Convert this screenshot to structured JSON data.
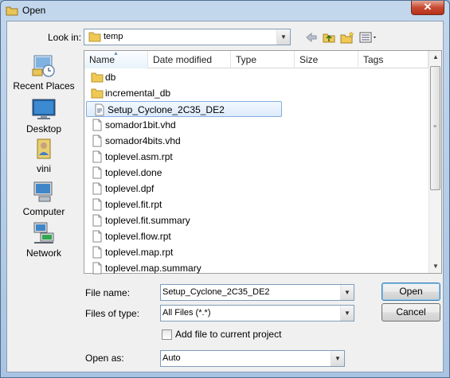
{
  "window": {
    "title": "Open",
    "close_glyph": "✕"
  },
  "toolbar": {
    "look_in_label": "Look in:",
    "look_in_value": "temp",
    "icons": [
      "back-arrow-icon",
      "up-folder-icon",
      "new-folder-icon",
      "view-menu-icon"
    ]
  },
  "places": [
    {
      "label": "Recent Places",
      "icon": "recent-places-icon"
    },
    {
      "label": "Desktop",
      "icon": "desktop-icon"
    },
    {
      "label": "vini",
      "icon": "user-folder-icon"
    },
    {
      "label": "Computer",
      "icon": "computer-icon"
    },
    {
      "label": "Network",
      "icon": "network-icon"
    }
  ],
  "columns": [
    "Name",
    "Date modified",
    "Type",
    "Size",
    "Tags"
  ],
  "files": [
    {
      "name": "db",
      "kind": "folder"
    },
    {
      "name": "incremental_db",
      "kind": "folder"
    },
    {
      "name": "Setup_Cyclone_2C35_DE2",
      "kind": "qsf",
      "selected": true
    },
    {
      "name": "somador1bit.vhd",
      "kind": "file"
    },
    {
      "name": "somador4bits.vhd",
      "kind": "file"
    },
    {
      "name": "toplevel.asm.rpt",
      "kind": "file"
    },
    {
      "name": "toplevel.done",
      "kind": "file"
    },
    {
      "name": "toplevel.dpf",
      "kind": "file"
    },
    {
      "name": "toplevel.fit.rpt",
      "kind": "file"
    },
    {
      "name": "toplevel.fit.summary",
      "kind": "file"
    },
    {
      "name": "toplevel.flow.rpt",
      "kind": "file"
    },
    {
      "name": "toplevel.map.rpt",
      "kind": "file"
    },
    {
      "name": "toplevel.map.summary",
      "kind": "file"
    }
  ],
  "form": {
    "file_name_label": "File name:",
    "file_name_value": "Setup_Cyclone_2C35_DE2",
    "files_of_type_label": "Files of type:",
    "files_of_type_value": "All Files (*.*)",
    "add_to_project_label": "Add file to current project",
    "add_to_project_checked": false,
    "open_as_label": "Open as:",
    "open_as_value": "Auto",
    "open_button": "Open",
    "cancel_button": "Cancel"
  },
  "colors": {
    "title_gradient_top": "#c3d7ec",
    "close_button": "#c74a32",
    "selection": "#dcebfb",
    "folder": "#e8c55a"
  }
}
